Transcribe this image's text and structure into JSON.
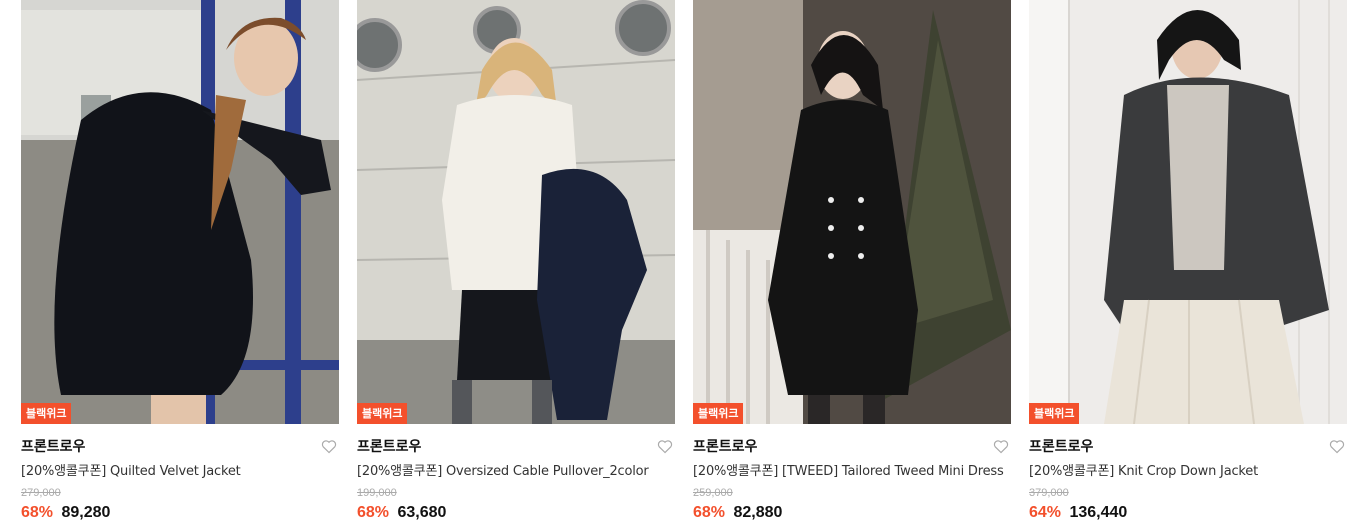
{
  "products": [
    {
      "badge": "블랙위크",
      "brand": "프론트로우",
      "title": "[20%앵콜쿠폰] Quilted Velvet Jacket",
      "original_price": "279,000",
      "discount": "68%",
      "price": "89,280",
      "photo": "model-in-quilted-velvet-jacket"
    },
    {
      "badge": "블랙위크",
      "brand": "프론트로우",
      "title": "[20%앵콜쿠폰] Oversized Cable Pullover_2color",
      "original_price": "199,000",
      "discount": "68%",
      "price": "63,680",
      "photo": "model-in-cable-pullover"
    },
    {
      "badge": "블랙위크",
      "brand": "프론트로우",
      "title": "[20%앵콜쿠폰] [TWEED] Tailored Tweed Mini Dress",
      "original_price": "259,000",
      "discount": "68%",
      "price": "82,880",
      "photo": "model-in-tweed-mini-dress"
    },
    {
      "badge": "블랙위크",
      "brand": "프론트로우",
      "title": "[20%앵콜쿠폰] Knit Crop Down Jacket",
      "original_price": "379,000",
      "discount": "64%",
      "price": "136,440",
      "photo": "model-in-knit-crop-down-jacket"
    }
  ],
  "colors": {
    "accent": "#f3502c",
    "text": "#111111",
    "muted": "#aaaaaa"
  }
}
